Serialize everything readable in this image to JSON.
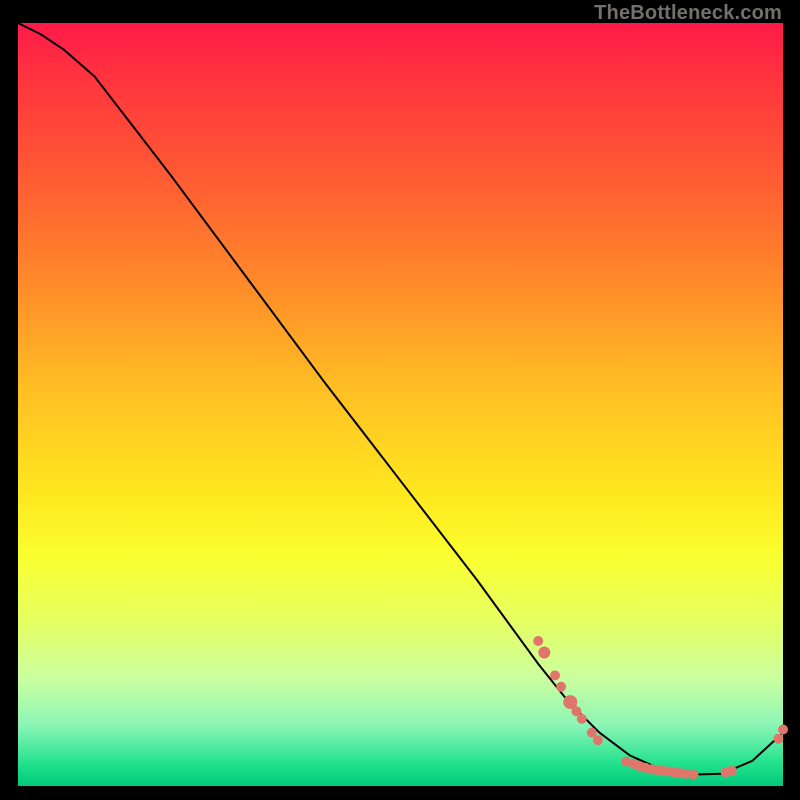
{
  "brand": "TheBottleneck.com",
  "chart_data": {
    "type": "line",
    "title": "",
    "xlabel": "",
    "ylabel": "",
    "xlim": [
      0,
      100
    ],
    "ylim": [
      0,
      100
    ],
    "series": [
      {
        "name": "curve",
        "x": [
          0,
          3,
          6,
          10,
          20,
          30,
          40,
          50,
          60,
          68,
          72,
          76,
          80,
          84,
          88,
          92,
          96,
          100
        ],
        "y": [
          100,
          98.5,
          96.5,
          93,
          80,
          66.5,
          53,
          40,
          27,
          16,
          11,
          7,
          4,
          2.2,
          1.5,
          1.6,
          3.3,
          7
        ]
      }
    ],
    "markers": {
      "name": "cluster",
      "points": [
        {
          "x": 68.0,
          "y": 19.0,
          "r": 5
        },
        {
          "x": 68.8,
          "y": 17.5,
          "r": 6
        },
        {
          "x": 70.2,
          "y": 14.5,
          "r": 5
        },
        {
          "x": 71.0,
          "y": 13.0,
          "r": 5
        },
        {
          "x": 72.2,
          "y": 11.0,
          "r": 7
        },
        {
          "x": 73.0,
          "y": 9.8,
          "r": 5
        },
        {
          "x": 73.7,
          "y": 8.8,
          "r": 5
        },
        {
          "x": 75.0,
          "y": 7.0,
          "r": 5
        },
        {
          "x": 75.8,
          "y": 6.0,
          "r": 5
        },
        {
          "x": 79.5,
          "y": 3.2,
          "r": 5
        },
        {
          "x": 80.5,
          "y": 2.9,
          "r": 5
        },
        {
          "x": 81.3,
          "y": 2.6,
          "r": 5
        },
        {
          "x": 82.0,
          "y": 2.4,
          "r": 5
        },
        {
          "x": 82.8,
          "y": 2.2,
          "r": 5
        },
        {
          "x": 83.5,
          "y": 2.1,
          "r": 5
        },
        {
          "x": 84.3,
          "y": 2.0,
          "r": 5
        },
        {
          "x": 85.0,
          "y": 1.9,
          "r": 5
        },
        {
          "x": 85.8,
          "y": 1.8,
          "r": 5
        },
        {
          "x": 86.5,
          "y": 1.7,
          "r": 5
        },
        {
          "x": 87.3,
          "y": 1.6,
          "r": 5
        },
        {
          "x": 88.3,
          "y": 1.5,
          "r": 5
        },
        {
          "x": 92.5,
          "y": 1.8,
          "r": 5
        },
        {
          "x": 93.3,
          "y": 2.0,
          "r": 5
        },
        {
          "x": 99.4,
          "y": 6.2,
          "r": 5
        },
        {
          "x": 100.0,
          "y": 7.4,
          "r": 5
        }
      ]
    }
  }
}
